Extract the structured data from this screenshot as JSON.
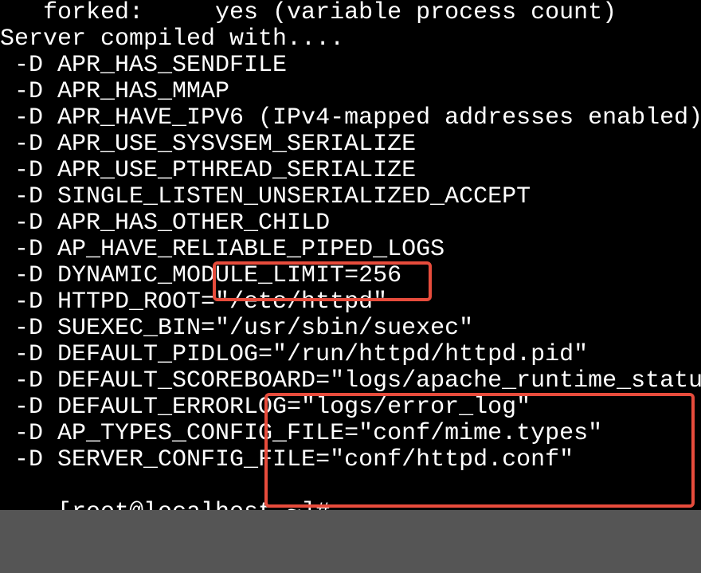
{
  "terminal": {
    "lines": [
      "   forked:     yes (variable process count)",
      "Server compiled with....",
      " -D APR_HAS_SENDFILE",
      " -D APR_HAS_MMAP",
      " -D APR_HAVE_IPV6 (IPv4-mapped addresses enabled)",
      " -D APR_USE_SYSVSEM_SERIALIZE",
      " -D APR_USE_PTHREAD_SERIALIZE",
      " -D SINGLE_LISTEN_UNSERIALIZED_ACCEPT",
      " -D APR_HAS_OTHER_CHILD",
      " -D AP_HAVE_RELIABLE_PIPED_LOGS",
      " -D DYNAMIC_MODULE_LIMIT=256",
      " -D HTTPD_ROOT=\"/etc/httpd\"",
      " -D SUEXEC_BIN=\"/usr/sbin/suexec\"",
      " -D DEFAULT_PIDLOG=\"/run/httpd/httpd.pid\"",
      " -D DEFAULT_SCOREBOARD=\"logs/apache_runtime_status\"",
      " -D DEFAULT_ERRORLOG=\"logs/error_log\"",
      " -D AP_TYPES_CONFIG_FILE=\"conf/mime.types\"",
      " -D SERVER_CONFIG_FILE=\"conf/httpd.conf\""
    ],
    "prompt": "[root@localhost ~]# "
  },
  "highlights": {
    "box1_target": "\"/etc/httpd\"",
    "box2_target": "\"conf/mime.types\" and \"conf/httpd.conf\""
  }
}
